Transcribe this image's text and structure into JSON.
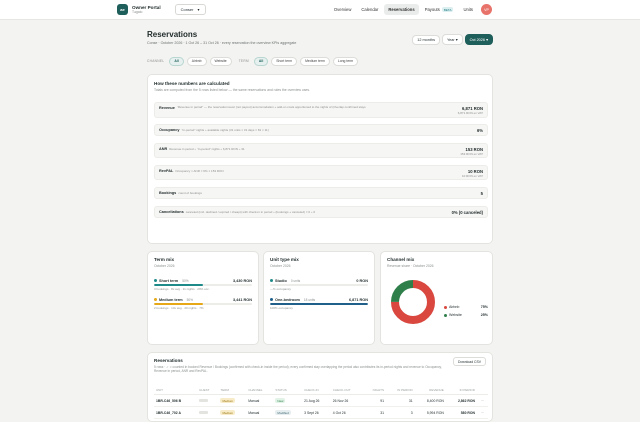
{
  "topbar": {
    "logo_text": "ae",
    "brand_title": "Owner Portal",
    "brand_sub": "Təgaio",
    "property": "Conser",
    "nav": [
      {
        "label": "Overview",
        "active": false
      },
      {
        "label": "Calendar",
        "active": false
      },
      {
        "label": "Reservations",
        "active": true
      },
      {
        "label": "Payouts",
        "badge": "BETA",
        "active": false
      },
      {
        "label": "Units",
        "active": false
      }
    ],
    "avatar_initials": "VP"
  },
  "header": {
    "title": "Reservations",
    "subtitle": "Conse · October 2026 · 1 Oct 26 – 31 Oct 26 · every reservation the overview KPIs aggregate",
    "period_buttons": [
      "12 months",
      "Year",
      "Oct 2026"
    ],
    "active_period": "Oct 2026"
  },
  "filters": {
    "channel_label": "CHANNEL",
    "channel_options": [
      "All",
      "Airbnb",
      "Website"
    ],
    "term_label": "TERM",
    "term_options": [
      "All",
      "Short term",
      "Medium term",
      "Long term"
    ]
  },
  "calc": {
    "title": "How these numbers are calculated",
    "subtitle": "Totals are computed from the 5 rows listed below — the same reservations and rules the overview uses.",
    "rows": [
      {
        "label": "Revenue",
        "formula": "“Revenue in period” — the reservation-level (not payout) accommodation + add-on costs apportioned to the nights of (Overlap confirmed stays",
        "value": "6,871 RON",
        "detail": "6,871 RON ex VAT"
      },
      {
        "label": "Occupancy",
        "formula": "“In-period” nights ÷ available nights (31 units × 31 days = 81 × 11)",
        "value": "6%",
        "detail": ""
      },
      {
        "label": "ANR",
        "formula": "Revenue in period ÷ “In-period” nights ÷ 6,871 RON ÷ 31",
        "value": "153 RON",
        "detail": "153 RON ex VAT"
      },
      {
        "label": "RevPAL",
        "formula": "Occupancy × ANR = 6% × 153 RON",
        "value": "10 RON",
        "detail": "10 RON ex VAT"
      },
      {
        "label": "Bookings",
        "formula": "count of bookings",
        "value": "5",
        "detail": ""
      },
      {
        "label": "Cancellations",
        "formula": "canceled (incl. declined / expired / cheapt) with check-in in period ÷ (bookings + canceled) = 0 ÷ 0",
        "value": "0% (0 canceled)",
        "detail": ""
      }
    ]
  },
  "term_mix": {
    "title": "Term mix",
    "subtitle": "October 2026",
    "items": [
      {
        "name": "Short term",
        "pct": "50%",
        "value": "3,430 RON",
        "meta": "3 bookings · 8x avg · 11 nights · 29% occ.",
        "fill": 0.5,
        "color": "#1f8a8a"
      },
      {
        "name": "Medium term",
        "pct": "50%",
        "value": "3,441 RON",
        "meta": "2 bookings · 14x avg · 20 nights · 7%",
        "fill": 0.5,
        "color": "#e6a817"
      }
    ]
  },
  "unit_mix": {
    "title": "Unit type mix",
    "subtitle": "October 2026",
    "items": [
      {
        "name": "Studio",
        "pct": "0 units",
        "value": "0 RON",
        "meta": "—% occupancy",
        "fill": 0,
        "color": "#1f8a8a"
      },
      {
        "name": "One-bedroom",
        "pct": "18 units",
        "value": "6,871 RON",
        "meta": "100% occupancy",
        "fill": 1,
        "color": "#1f5f8a"
      }
    ]
  },
  "channel_mix": {
    "title": "Channel mix",
    "subtitle": "Revenue share · October 2026",
    "items": [
      {
        "name": "Airbnb",
        "value": "75%",
        "share": 0.75,
        "color": "#d9473f"
      },
      {
        "name": "Website",
        "value": "25%",
        "share": 0.25,
        "color": "#2f7f4b"
      }
    ]
  },
  "reservations": {
    "title": "Reservations",
    "download": "Download CSV",
    "note": "5 rows · ✓ = counted in booked Revenue / Bookings (confirmed with check-in inside the period); every confirmed stay overlapping the period also contributes its in-period nights and revenue to Occupancy, Revenue in period, ANR and RevPAL.",
    "columns": [
      "UNIT",
      "GUEST",
      "TERM",
      "CHANNEL",
      "STATUS",
      "CHECK-IN",
      "CHECK-OUT",
      "NIGHTS",
      "IN PERIOD",
      "REVENUE",
      "IN PERIOD",
      ""
    ],
    "rows": [
      {
        "unit": "1BR-C46_506 B",
        "term": "Medium",
        "channel": "Manual",
        "status": "New",
        "checkin": "21 Aug 26",
        "checkout": "26 Nov 26",
        "nights": "91",
        "in_period_n": "31",
        "revenue": "8,400 RON",
        "in_period_r": "2,862 RON"
      },
      {
        "unit": "1BR-C46_702 A",
        "term": "Medium",
        "channel": "Manual",
        "status": "Modified",
        "checkin": "3 Sept 26",
        "checkout": "4 Oct 26",
        "nights": "31",
        "in_period_n": "3",
        "revenue": "5,994 RON",
        "in_period_r": "580 RON"
      }
    ]
  }
}
